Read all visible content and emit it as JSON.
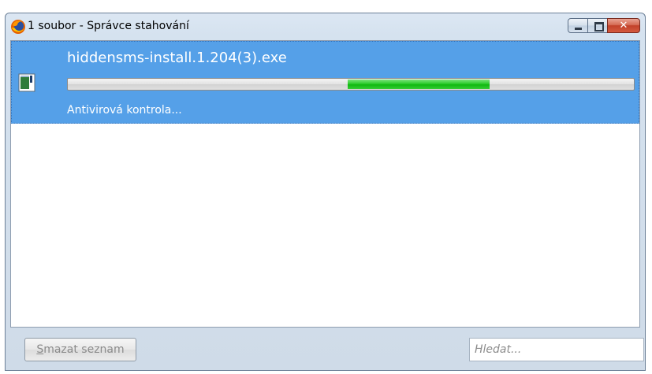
{
  "window": {
    "title": "1 soubor - Správce stahování",
    "app_icon": "firefox-icon",
    "caption_buttons": {
      "minimize_icon": "minimize-icon",
      "maximize_icon": "maximize-icon",
      "close_icon": "close-icon",
      "close_glyph": "✕"
    }
  },
  "downloads": {
    "items": [
      {
        "filename": "hiddensms-install.1.204(3).exe",
        "status": "Antivirová kontrola...",
        "file_icon": "executable-file-icon",
        "progress": {
          "mode": "indeterminate",
          "chunk_start": 0.495,
          "chunk_end": 0.745
        }
      }
    ]
  },
  "footer": {
    "clear_button_accel": "S",
    "clear_button_rest": "mazat seznam",
    "search_placeholder": "Hledat..."
  },
  "colors": {
    "selection": "#55a0e8",
    "progress_fill": "#22c322",
    "close_button": "#c2412a"
  }
}
